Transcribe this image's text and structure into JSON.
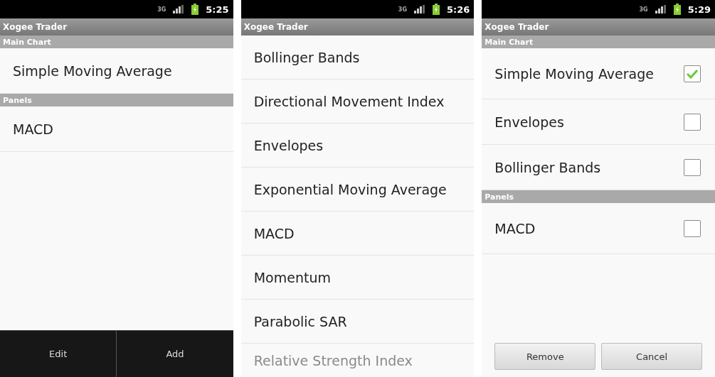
{
  "screens": [
    {
      "status_bar": {
        "network": "3G",
        "time": "5:25"
      },
      "app_title": "Xogee Trader",
      "sections": [
        {
          "header": "Main Chart",
          "items": [
            {
              "label": "Simple Moving Average",
              "kind": "plain"
            }
          ]
        },
        {
          "header": "Panels",
          "items": [
            {
              "label": "MACD",
              "kind": "plain"
            }
          ]
        }
      ],
      "actions": {
        "kind": "bar",
        "buttons": [
          "Edit",
          "Add"
        ]
      }
    },
    {
      "status_bar": {
        "network": "3G",
        "time": "5:26"
      },
      "app_title": "Xogee Trader",
      "sections": [
        {
          "items": [
            {
              "label": "Bollinger Bands",
              "kind": "plain"
            },
            {
              "label": "Directional Movement Index",
              "kind": "plain"
            },
            {
              "label": "Envelopes",
              "kind": "plain"
            },
            {
              "label": "Exponential Moving Average",
              "kind": "plain"
            },
            {
              "label": "MACD",
              "kind": "plain"
            },
            {
              "label": "Momentum",
              "kind": "plain"
            },
            {
              "label": "Parabolic SAR",
              "kind": "plain"
            },
            {
              "label": "Relative Strength Index",
              "kind": "faded"
            }
          ]
        }
      ]
    },
    {
      "status_bar": {
        "network": "3G",
        "time": "5:29"
      },
      "app_title": "Xogee Trader",
      "sections": [
        {
          "header": "Main Chart",
          "items": [
            {
              "label": "Simple Moving Average",
              "kind": "check",
              "checked": true
            },
            {
              "label": "Envelopes",
              "kind": "check",
              "checked": false
            },
            {
              "label": "Bollinger Bands",
              "kind": "check",
              "checked": false
            }
          ]
        },
        {
          "header": "Panels",
          "items": [
            {
              "label": "MACD",
              "kind": "check",
              "checked": false
            }
          ]
        }
      ],
      "actions": {
        "kind": "buttons",
        "buttons": [
          "Remove",
          "Cancel"
        ]
      }
    }
  ]
}
